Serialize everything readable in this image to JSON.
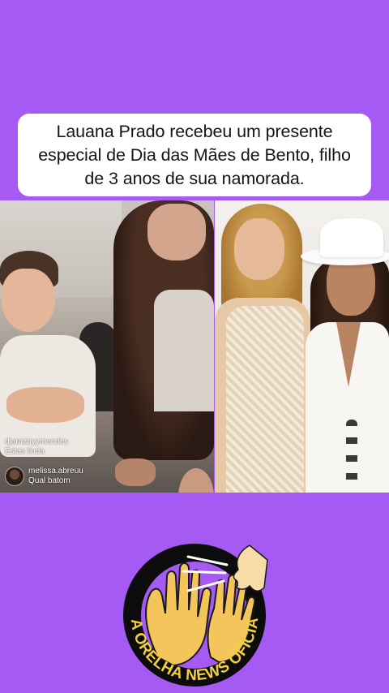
{
  "headline": {
    "text": "Lauana Prado recebeu um presente especial de Dia das Mães de Bento, filho de 3 anos de sua namorada."
  },
  "live_comments": [
    {
      "user": "djamanyymendes",
      "message": "Estas linda"
    },
    {
      "user": "melissa.abreuu",
      "message": "Qual batom"
    }
  ],
  "logo": {
    "text": "NA ORELHA NEWS OFICIAL"
  },
  "colors": {
    "background": "#a55af3",
    "logo_ring": "#0c0c0c",
    "logo_text": "#f2d03b"
  }
}
